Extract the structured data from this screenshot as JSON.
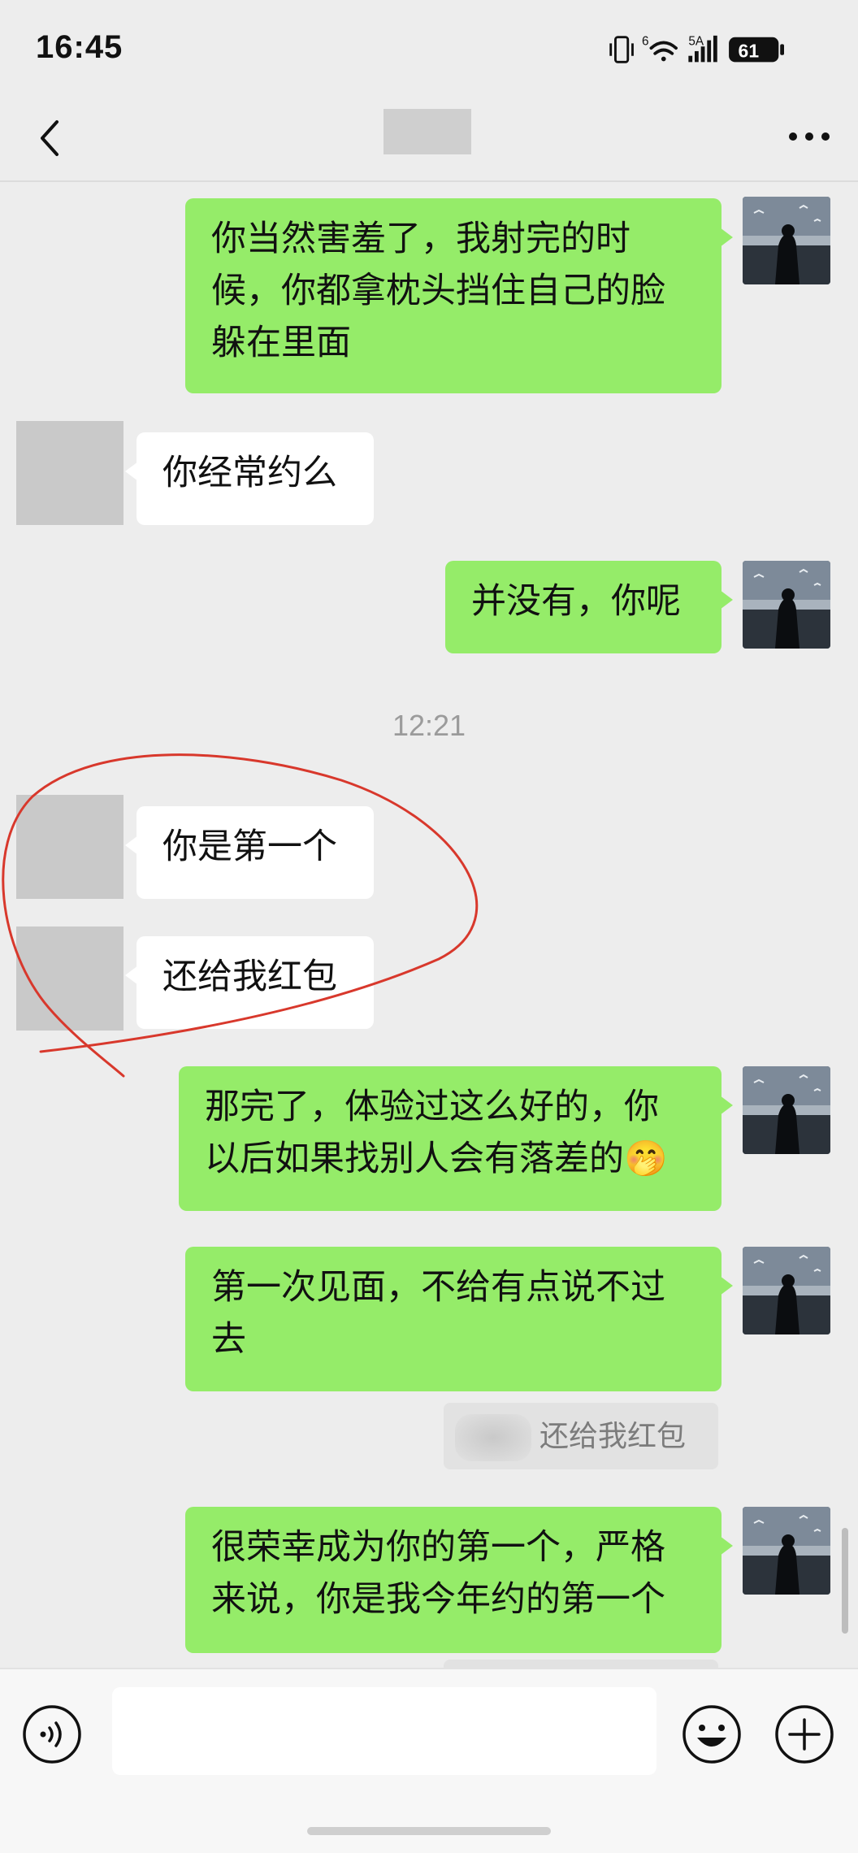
{
  "status_bar": {
    "time": "16:45",
    "network": "5A",
    "signal_prefix": "6",
    "battery": "61"
  },
  "header": {
    "back_icon": "chevron-left-icon",
    "more_icon": "more-horizontal-icon"
  },
  "messages": [
    {
      "side": "self",
      "text_lines": [
        "你当然害羞了，我射完的时",
        "候，你都拿枕头挡住自己的脸",
        "躲在里面"
      ]
    },
    {
      "side": "peer",
      "text_lines": [
        "你经常约么"
      ]
    },
    {
      "side": "self",
      "text_lines": [
        "并没有，你呢"
      ]
    },
    {
      "side": "peer",
      "text_lines": [
        "你是第一个"
      ]
    },
    {
      "side": "peer",
      "text_lines": [
        "还给我红包"
      ]
    },
    {
      "side": "self",
      "text_lines": [
        "那完了，体验过这么好的，你",
        "以后如果找别人会有落差的"
      ]
    },
    {
      "side": "self",
      "text_lines": [
        "第一次见面，不给有点说不过",
        "去"
      ]
    },
    {
      "side": "self",
      "text_lines": [
        "很荣幸成为你的第一个，严格",
        "来说，你是我今年约的第一个"
      ]
    }
  ],
  "timestamp": "12:21",
  "quote": {
    "text": "还给我红包"
  },
  "emoji": {
    "name": "thinking-face-icon",
    "glyph": "🤭"
  },
  "input_bar": {
    "voice_icon": "voice-icon",
    "emoji_icon": "emoji-icon",
    "plus_icon": "plus-icon",
    "value": ""
  },
  "colors": {
    "self_bubble": "#95ec69",
    "peer_bubble": "#ffffff",
    "background": "#ededed",
    "annotation": "#d8382c"
  }
}
